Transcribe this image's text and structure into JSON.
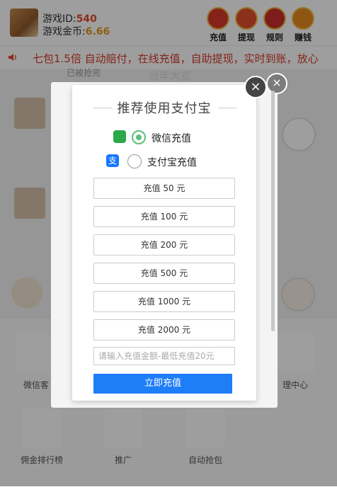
{
  "header": {
    "id_label": "游戏ID:",
    "id_value": "540",
    "coins_label": "游戏金币:",
    "coins_value": "6.66",
    "icons": [
      {
        "name": "recharge-icon",
        "label": "充值"
      },
      {
        "name": "withdraw-icon",
        "label": "提现"
      },
      {
        "name": "rules-icon",
        "label": "规则"
      },
      {
        "name": "earn-icon",
        "label": "赚钱"
      }
    ]
  },
  "notice": {
    "text": "七包1.5倍 自动赔付，在线充值，自助提现，实时到账，放心"
  },
  "background": {
    "tab_left": "已被抢完",
    "back_title": "当年大吉",
    "grid": [
      {
        "label": "微信客"
      },
      {
        "label": "理中心"
      },
      {
        "label": "佣金排行榜"
      },
      {
        "label": "推广"
      },
      {
        "label": "自动抢包"
      }
    ]
  },
  "modal": {
    "title": "推荐使用支付宝",
    "methods": [
      {
        "label": "微信充值",
        "checked": true
      },
      {
        "label": "支付宝充值",
        "checked": false
      }
    ],
    "amounts": [
      "充值 50 元",
      "充值 100 元",
      "充值 200 元",
      "充值 500 元",
      "充值 1000 元",
      "充值 2000 元"
    ],
    "input_placeholder": "请输入充值金额-最低充值20元",
    "submit_label": "立即充值",
    "close_symbol": "×"
  }
}
